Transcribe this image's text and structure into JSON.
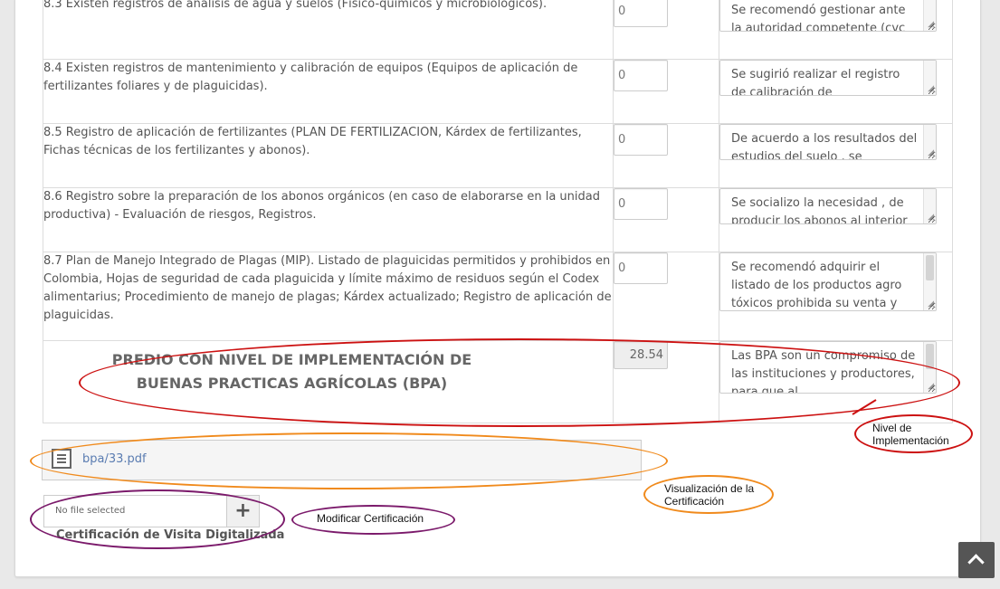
{
  "rows": [
    {
      "text": "8.3 Existen registros de análisis de agua y suelos (Físico-químicos y microbiológicos).",
      "score": "0",
      "obs": "Se recomendó  gestionar  ante la autoridad competente (cvc"
    },
    {
      "text": "8.4 Existen registros de mantenimiento y calibración de equipos (Equipos de aplicación de fertilizantes foliares y de plaguicidas).",
      "score": "0",
      "obs": "Se sugirió realizar el registro de calibración de"
    },
    {
      "text": "8.5 Registro de aplicación de fertilizantes (PLAN DE FERTILIZACION, Kárdex de fertilizantes, Fichas técnicas de los fertilizantes y abonos).",
      "score": "0",
      "obs": "De acuerdo a los resultados del estudios del suelo , se"
    },
    {
      "text": "8.6 Registro sobre la preparación de los abonos orgánicos (en caso de elaborarse en la unidad productiva) - Evaluación de riesgos, Registros.",
      "score": "0",
      "obs": "Se socializo la necesidad , de producir los abonos al interior"
    },
    {
      "text": "8.7 Plan de Manejo Integrado de Plagas (MIP). Listado de plaguicidas permitidos y prohibidos en Colombia, Hojas de seguridad de cada plaguicida y límite máximo de residuos según el Codex alimentarius; Procedimiento de manejo de plagas; Kárdex actualizado; Registro de aplicación de plaguicidas.",
      "score": "0",
      "obs": "Se recomendó  adquirir el listado de los productos agro tóxicos prohibida su venta y"
    }
  ],
  "total": {
    "label_line1": "PREDIO CON NIVEL DE IMPLEMENTACIÓN DE",
    "label_line2": "BUENAS PRACTICAS AGRÍCOLAS (BPA)",
    "value": "28.54",
    "obs": "Las BPA son un compromiso de las instituciones y productores, para que al"
  },
  "file": {
    "link": "bpa/33.pdf",
    "icon": "document-icon"
  },
  "upload": {
    "status": "No file selected",
    "button": "+",
    "caption": "Certificación de Visita Digitalizada"
  },
  "annotations": {
    "nivel": "Nivel de Implementación",
    "visualizacion": "Visualización de la Certificación",
    "modificar": "Modificar Certificación"
  },
  "colors": {
    "red": "#cc1111",
    "orange": "#f08a1c",
    "purple": "#7b1a6b",
    "link": "#5a7cb1"
  }
}
